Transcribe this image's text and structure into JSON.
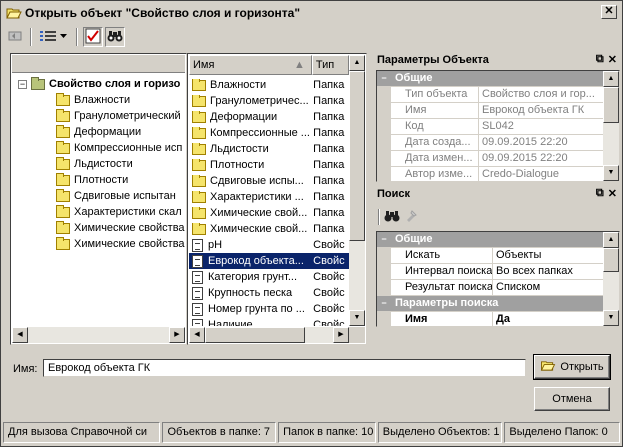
{
  "window": {
    "title": "Открыть объект \"Свойство слоя и горизонта\"",
    "close": "✕"
  },
  "tree": {
    "root": "Свойство слоя и горизо",
    "items": [
      "Влажности",
      "Гранулометрический",
      "Деформации",
      "Компрессионные исп",
      "Льдистости",
      "Плотности",
      "Сдвиговые испытан",
      "Характеристики скал",
      "Химические свойства",
      "Химические свойства"
    ]
  },
  "list": {
    "col_name": "Имя",
    "col_type": "Тип",
    "rows": [
      {
        "name": "Влажности",
        "type": "Папка",
        "icon": "folder"
      },
      {
        "name": "Гранулометричес...",
        "type": "Папка",
        "icon": "folder"
      },
      {
        "name": "Деформации",
        "type": "Папка",
        "icon": "folder"
      },
      {
        "name": "Компрессионные ...",
        "type": "Папка",
        "icon": "folder"
      },
      {
        "name": "Льдистости",
        "type": "Папка",
        "icon": "folder"
      },
      {
        "name": "Плотности",
        "type": "Папка",
        "icon": "folder"
      },
      {
        "name": "Сдвиговые испы...",
        "type": "Папка",
        "icon": "folder"
      },
      {
        "name": "Характеристики ...",
        "type": "Папка",
        "icon": "folder"
      },
      {
        "name": "Химические свой...",
        "type": "Папка",
        "icon": "folder"
      },
      {
        "name": "Химические свой...",
        "type": "Папка",
        "icon": "folder"
      },
      {
        "name": "pH",
        "type": "Свойс",
        "icon": "document"
      },
      {
        "name": "Еврокод объекта...",
        "type": "Свойс",
        "icon": "document",
        "selected": true
      },
      {
        "name": "Категория грунт...",
        "type": "Свойс",
        "icon": "document"
      },
      {
        "name": "Крупность песка",
        "type": "Свойс",
        "icon": "document"
      },
      {
        "name": "Номер грунта по ...",
        "type": "Свойс",
        "icon": "document"
      },
      {
        "name": "Наличие ...",
        "type": "Свойс",
        "icon": "document"
      }
    ]
  },
  "params": {
    "title": "Параметры Объекта",
    "category": "Общие",
    "rows": [
      {
        "k": "Тип объекта",
        "v": "Свойство слоя и гор..."
      },
      {
        "k": "Имя",
        "v": "Еврокод объекта ГК"
      },
      {
        "k": "Код",
        "v": "SL042"
      },
      {
        "k": "Дата созда...",
        "v": "09.09.2015 22:20"
      },
      {
        "k": "Дата измен...",
        "v": "09.09.2015 22:20"
      },
      {
        "k": "Автор изме...",
        "v": "Credo-Dialogue"
      }
    ]
  },
  "search": {
    "title": "Поиск",
    "category": "Общие",
    "rows": [
      {
        "k": "Искать",
        "v": "Объекты"
      },
      {
        "k": "Интервал поиска",
        "v": "Во всех папках"
      },
      {
        "k": "Результат поиска",
        "v": "Списком"
      }
    ],
    "category2": "Параметры поиска",
    "hdr_k": "Имя",
    "hdr_v": "Да"
  },
  "name_label": "Имя:",
  "name_value": "Еврокод объекта ГК",
  "open_button": "Открыть",
  "cancel_button": "Отмена",
  "status": [
    "Для вызова Справочной си",
    "Объектов в папке: 7",
    "Папок в папке: 10",
    "Выделено Объектов: 1",
    "Выделено Папок: 0"
  ],
  "colors": {
    "selection": "#0a246a",
    "chrome": "#d4d0c8",
    "folder": "#f5e46b"
  },
  "icons": [
    "open-folder-icon",
    "back-icon",
    "view-list-icon",
    "checkmark-icon",
    "binoculars-icon",
    "flashlight-icon",
    "pin-icon",
    "close-icon"
  ]
}
